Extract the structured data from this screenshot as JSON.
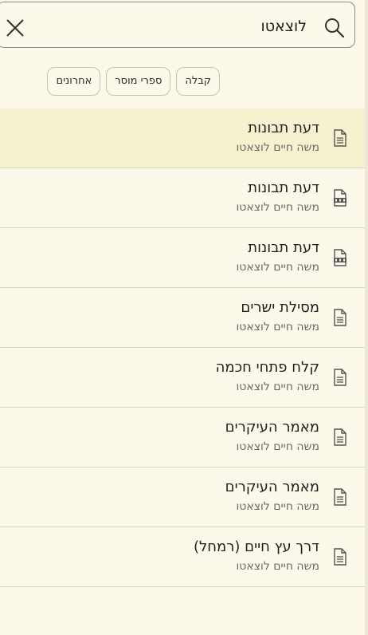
{
  "search": {
    "query": "לוצאטו"
  },
  "filters": [
    {
      "label": "אחרונים"
    },
    {
      "label": "ספרי מוסר"
    },
    {
      "label": "קבלה"
    }
  ],
  "results": [
    {
      "title": "דעת תבונות",
      "author": "משה חיים לוצאטו",
      "icon": "document-icon",
      "selected": true
    },
    {
      "title": "דעת תבונות",
      "author": "משה חיים לוצאטו",
      "icon": "pdf-icon"
    },
    {
      "title": "דעת תבונות",
      "author": "משה חיים לוצאטו",
      "icon": "pdf-icon"
    },
    {
      "title": "מסילת ישרים",
      "author": "משה חיים לוצאטו",
      "icon": "document-icon"
    },
    {
      "title": "קלח פתחי חכמה",
      "author": "משה חיים לוצאטו",
      "icon": "document-icon"
    },
    {
      "title": "מאמר העיקרים",
      "author": "משה חיים לוצאטו",
      "icon": "document-icon"
    },
    {
      "title": "מאמר העיקרים",
      "author": "משה חיים לוצאטו",
      "icon": "document-icon"
    },
    {
      "title": "דרך עץ חיים (רמחל)",
      "author": "משה חיים לוצאטו",
      "icon": "document-icon"
    }
  ],
  "colors": {
    "background": "#fcf8ea",
    "selected_row": "#f6f1ce",
    "divider": "#d6d3c9"
  }
}
